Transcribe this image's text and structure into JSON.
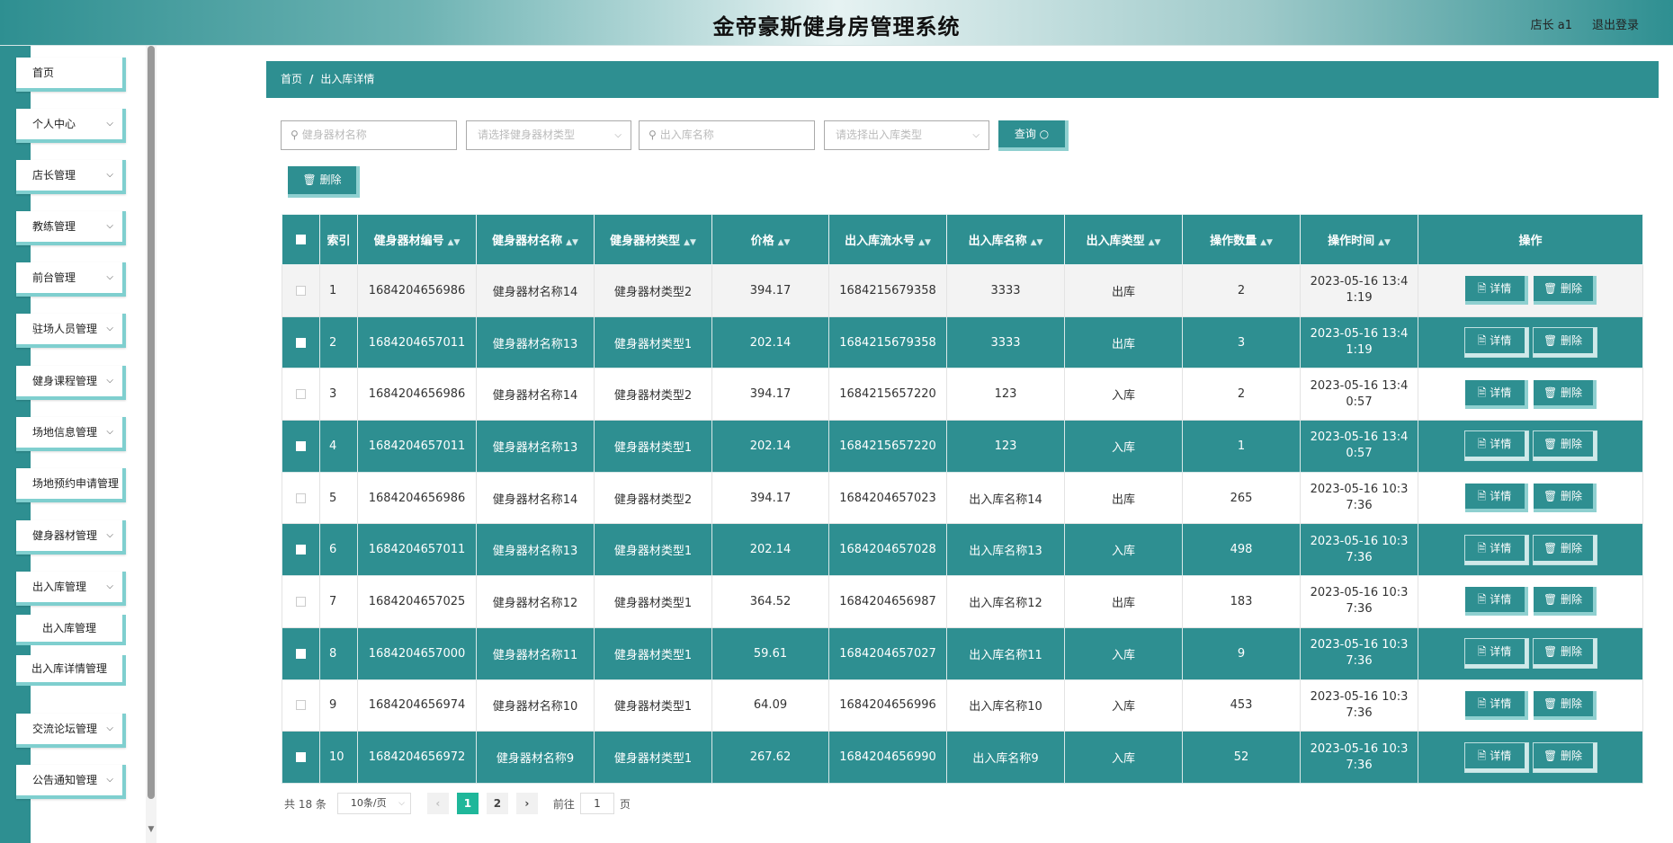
{
  "header": {
    "title": "金帝豪斯健身房管理系统",
    "user_label": "店长 a1",
    "logout_label": "退出登录"
  },
  "sidebar": {
    "items": [
      {
        "label": "首页",
        "expandable": false
      },
      {
        "label": "个人中心",
        "expandable": true
      },
      {
        "label": "店长管理",
        "expandable": true
      },
      {
        "label": "教练管理",
        "expandable": true
      },
      {
        "label": "前台管理",
        "expandable": true
      },
      {
        "label": "驻场人员管理",
        "expandable": true
      },
      {
        "label": "健身课程管理",
        "expandable": true
      },
      {
        "label": "场地信息管理",
        "expandable": true
      },
      {
        "label": "场地预约申请管理",
        "expandable": false
      },
      {
        "label": "健身器材管理",
        "expandable": true
      },
      {
        "label": "出入库管理",
        "expandable": true
      },
      {
        "label": "交流论坛管理",
        "expandable": true
      },
      {
        "label": "公告通知管理",
        "expandable": true
      }
    ],
    "subitems": [
      "出入库管理",
      "出入库详情管理"
    ]
  },
  "breadcrumb": {
    "home": "首页",
    "sep": "/",
    "current": "出入库详情"
  },
  "search": {
    "equipment_name_placeholder": "健身器材名称",
    "equipment_type_placeholder": "请选择健身器材类型",
    "io_name_placeholder": "出入库名称",
    "io_type_placeholder": "请选择出入库类型",
    "query_label": "查询 ○"
  },
  "toolbar": {
    "delete_label": "🗑 删除"
  },
  "table": {
    "headers": [
      "索引",
      "健身器材编号",
      "健身器材名称",
      "健身器材类型",
      "价格",
      "出入库流水号",
      "出入库名称",
      "出入库类型",
      "操作数量",
      "操作时间",
      "操作"
    ],
    "sort_glyph": "▲▼",
    "detail_label": "🗎 详情",
    "row_delete_label": "🗑 删除",
    "rows": [
      [
        "1",
        "1684204656986",
        "健身器材名称14",
        "健身器材类型2",
        "394.17",
        "1684215679358",
        "3333",
        "出库",
        "2",
        "2023-05-16 13:41:19"
      ],
      [
        "2",
        "1684204657011",
        "健身器材名称13",
        "健身器材类型1",
        "202.14",
        "1684215679358",
        "3333",
        "出库",
        "3",
        "2023-05-16 13:41:19"
      ],
      [
        "3",
        "1684204656986",
        "健身器材名称14",
        "健身器材类型2",
        "394.17",
        "1684215657220",
        "123",
        "入库",
        "2",
        "2023-05-16 13:40:57"
      ],
      [
        "4",
        "1684204657011",
        "健身器材名称13",
        "健身器材类型1",
        "202.14",
        "1684215657220",
        "123",
        "入库",
        "1",
        "2023-05-16 13:40:57"
      ],
      [
        "5",
        "1684204656986",
        "健身器材名称14",
        "健身器材类型2",
        "394.17",
        "1684204657023",
        "出入库名称14",
        "出库",
        "265",
        "2023-05-16 10:37:36"
      ],
      [
        "6",
        "1684204657011",
        "健身器材名称13",
        "健身器材类型1",
        "202.14",
        "1684204657028",
        "出入库名称13",
        "入库",
        "498",
        "2023-05-16 10:37:36"
      ],
      [
        "7",
        "1684204657025",
        "健身器材名称12",
        "健身器材类型1",
        "364.52",
        "1684204656987",
        "出入库名称12",
        "出库",
        "183",
        "2023-05-16 10:37:36"
      ],
      [
        "8",
        "1684204657000",
        "健身器材名称11",
        "健身器材类型1",
        "59.61",
        "1684204657027",
        "出入库名称11",
        "入库",
        "9",
        "2023-05-16 10:37:36"
      ],
      [
        "9",
        "1684204656974",
        "健身器材名称10",
        "健身器材类型1",
        "64.09",
        "1684204656996",
        "出入库名称10",
        "入库",
        "453",
        "2023-05-16 10:37:36"
      ],
      [
        "10",
        "1684204656972",
        "健身器材名称9",
        "健身器材类型1",
        "267.62",
        "1684204656990",
        "出入库名称9",
        "入库",
        "52",
        "2023-05-16 10:37:36"
      ]
    ]
  },
  "pagination": {
    "total_label": "共 18 条",
    "page_size": "10条/页",
    "prev": "‹",
    "next": "›",
    "pages": [
      "1",
      "2"
    ],
    "goto_prefix": "前往",
    "goto_value": "1",
    "goto_suffix": "页"
  },
  "colors": {
    "primary": "#2e8f91",
    "accent": "#8fd0d0",
    "active_page": "#1fb79a"
  }
}
